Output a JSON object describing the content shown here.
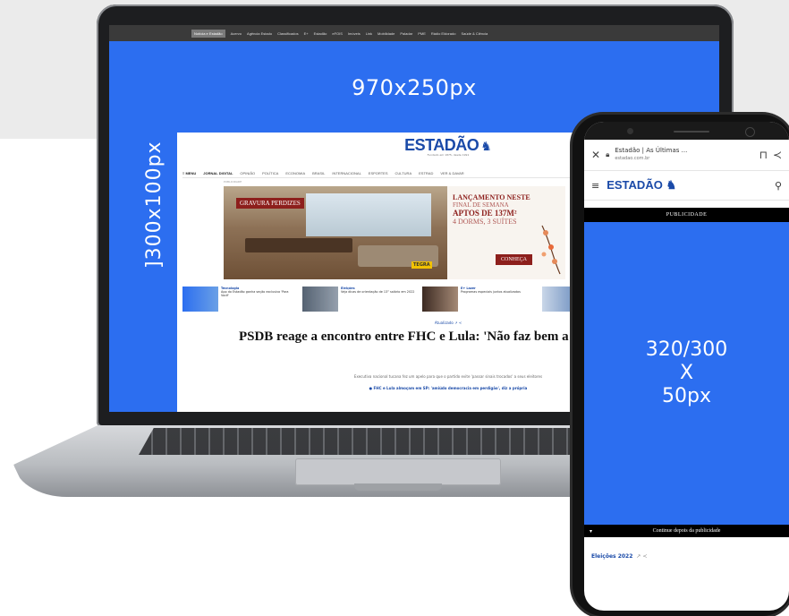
{
  "laptop": {
    "menu_items": [
      "Notícia e Estadão",
      "Acervo",
      "Agência Estado",
      "Classificados",
      "E+",
      "Estadão",
      "eFOIS",
      "Imóveis",
      "Link",
      "Mobilidade",
      "Paladar",
      "PME",
      "Rádio Eldorado",
      "Saúde & Ciência"
    ],
    "ad_label_top": "970x250px",
    "ad_label_side": "]300x100px",
    "site": {
      "logo": "ESTADÃO",
      "tagline": "Fundado em 1875, desde 1991",
      "nav": [
        "≡ MENU",
        "JORNAL DIGITAL",
        "OPINIÃO",
        "POLÍTICA",
        "ECONOMIA",
        "BRASIL",
        "INTERNACIONAL",
        "ESPORTES",
        "CULTURA",
        "ESTRAD",
        "VER & DAVAR"
      ],
      "pub_label": "PUBLICIDADE",
      "ad": {
        "tag": "GRAVURA PERDIZES",
        "stamp": "TEGRA",
        "line1": "LANÇAMENTO NESTE",
        "line2": "FINAL DE SEMANA",
        "line3": "APTOS DE 137M²",
        "line4": "4 DORMS, 3 SUÍTES",
        "cta": "CONHEÇA"
      },
      "news": [
        {
          "cat": "Tecnologia",
          "text": "App do Estadão ganha seção exclusiva 'Para Você'"
        },
        {
          "cat": "Eleições",
          "text": "Veja dicas de orientação de 13° salário em 2022"
        },
        {
          "cat": "E+ Lazer",
          "text": "Programas especiais juntos atualizados"
        },
        {
          "cat": "",
          "text": ""
        }
      ],
      "article_meta": "Atualizado",
      "headline": "PSDB reage a encontro entre FHC e Lula: 'Não faz bem a p... candidato nosso'",
      "subline": "Executiva nacional tucana fez um apelo para que o partido evite 'passar sinais trocados' a seus eleitores",
      "bullet": "FHC e Lula almoçam em SP: 'amiúdo democracia em perdigão', diz a própria"
    }
  },
  "phone": {
    "browser": {
      "title": "Estadão | As Últimas ...",
      "url": "estadao.com.br"
    },
    "logo": "ESTADÃO",
    "pub_bar": "PUBLICIDADE",
    "ad_line1": "320/300",
    "ad_line2": "X",
    "ad_line3": "50px",
    "continue_text": "Continue depois da publicidade",
    "meta": "Eleições 2022"
  },
  "colors": {
    "ad_blue": "#2c6ef0",
    "estadao_blue": "#1a4aa8"
  }
}
